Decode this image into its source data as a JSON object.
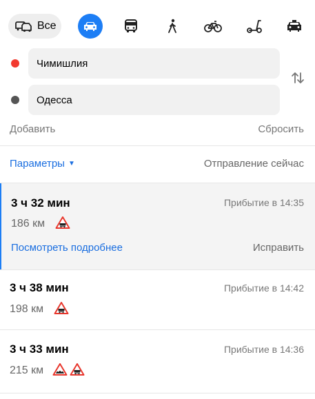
{
  "modes": {
    "all_label": "Все",
    "items": [
      {
        "name": "all",
        "icon": "car-bus-icon"
      },
      {
        "name": "car",
        "icon": "car-icon",
        "active": true
      },
      {
        "name": "bus",
        "icon": "bus-icon"
      },
      {
        "name": "walk",
        "icon": "pedestrian-icon"
      },
      {
        "name": "bike",
        "icon": "bicycle-icon"
      },
      {
        "name": "scooter",
        "icon": "scooter-icon"
      },
      {
        "name": "taxi",
        "icon": "taxi-icon"
      }
    ]
  },
  "points": {
    "from": "Чимишлия",
    "to": "Одесса"
  },
  "actions": {
    "add": "Добавить",
    "reset": "Сбросить",
    "params": "Параметры",
    "departure": "Отправление сейчас"
  },
  "routes": [
    {
      "time": "3 ч 32 мин",
      "arrival": "Прибытие в 14:35",
      "distance": "186 км",
      "warnings": [
        "railway-crossing-icon"
      ],
      "details": "Посмотреть подробнее",
      "fix": "Исправить",
      "selected": true
    },
    {
      "time": "3 ч 38 мин",
      "arrival": "Прибытие в 14:42",
      "distance": "198 км",
      "warnings": [
        "railway-crossing-icon"
      ]
    },
    {
      "time": "3 ч 33 мин",
      "arrival": "Прибытие в 14:36",
      "distance": "215 км",
      "warnings": [
        "rough-road-icon",
        "railway-crossing-icon"
      ]
    }
  ],
  "colors": {
    "accent": "#1d7ef5",
    "link": "#1a6ee0",
    "from_dot": "#f23a2f",
    "to_dot": "#555555",
    "warning": "#e8362c"
  }
}
